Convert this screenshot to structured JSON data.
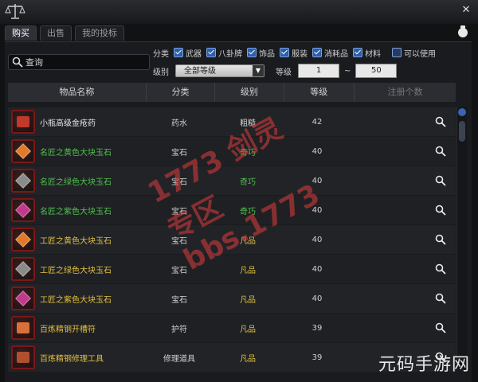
{
  "tabs": [
    {
      "label": "购买",
      "active": true
    },
    {
      "label": "出售",
      "active": false
    },
    {
      "label": "我的投标",
      "active": false
    }
  ],
  "search": {
    "value": "查询"
  },
  "filters": {
    "label": "分类",
    "options": [
      {
        "label": "武器",
        "checked": true
      },
      {
        "label": "八卦牌",
        "checked": true
      },
      {
        "label": "饰品",
        "checked": true
      },
      {
        "label": "服装",
        "checked": true
      },
      {
        "label": "消耗品",
        "checked": true
      },
      {
        "label": "材料",
        "checked": true
      },
      {
        "label": "可以使用",
        "checked": false
      }
    ]
  },
  "level_filter": {
    "label": "级别",
    "selected": "全部等级",
    "level_label": "等级",
    "min": "1",
    "separator": "~",
    "max": "50"
  },
  "columns": [
    "物品名称",
    "分类",
    "级别",
    "等级",
    "注册个数"
  ],
  "grade_colors": {
    "粗糙": "#d0d0d0",
    "奇巧": "#4fc24f",
    "凡品": "#e0c040"
  },
  "rows": [
    {
      "name": "小瓶高级金疮药",
      "category": "药水",
      "grade": "粗糙",
      "level": "42",
      "icon": "potion-icon",
      "name_color": "#e8e8e8",
      "icon_color": "#c0392b"
    },
    {
      "name": "名匠之黄色大块玉石",
      "category": "宝石",
      "grade": "奇巧",
      "level": "40",
      "icon": "yellow-gem-icon",
      "name_color": "#4fc24f",
      "icon_color": "#e07a2a"
    },
    {
      "name": "名匠之绿色大块玉石",
      "category": "宝石",
      "grade": "奇巧",
      "level": "40",
      "icon": "green-gem-icon",
      "name_color": "#4fc24f",
      "icon_color": "#8a8a8a"
    },
    {
      "name": "名匠之紫色大块玉石",
      "category": "宝石",
      "grade": "奇巧",
      "level": "40",
      "icon": "purple-gem-icon",
      "name_color": "#4fc24f",
      "icon_color": "#c03a8a"
    },
    {
      "name": "工匠之黄色大块玉石",
      "category": "宝石",
      "grade": "凡品",
      "level": "40",
      "icon": "yellow-gem-icon",
      "name_color": "#e0c040",
      "icon_color": "#e07a2a"
    },
    {
      "name": "工匠之绿色大块玉石",
      "category": "宝石",
      "grade": "凡品",
      "level": "40",
      "icon": "green-gem-icon",
      "name_color": "#e0c040",
      "icon_color": "#8a8a8a"
    },
    {
      "name": "工匠之紫色大块玉石",
      "category": "宝石",
      "grade": "凡品",
      "level": "40",
      "icon": "purple-gem-icon",
      "name_color": "#e0c040",
      "icon_color": "#c03a8a"
    },
    {
      "name": "百炼精钢开槽符",
      "category": "护符",
      "grade": "凡品",
      "level": "39",
      "icon": "talisman-icon",
      "name_color": "#e0c040",
      "icon_color": "#d9703a"
    },
    {
      "name": "百炼精钢修理工具",
      "category": "修理道具",
      "grade": "凡品",
      "level": "39",
      "icon": "repair-tool-icon",
      "name_color": "#e0c040",
      "icon_color": "#b05030"
    }
  ],
  "watermark": "1773 剑灵专区 bbs.1773",
  "corner_watermark": "元码手游网"
}
